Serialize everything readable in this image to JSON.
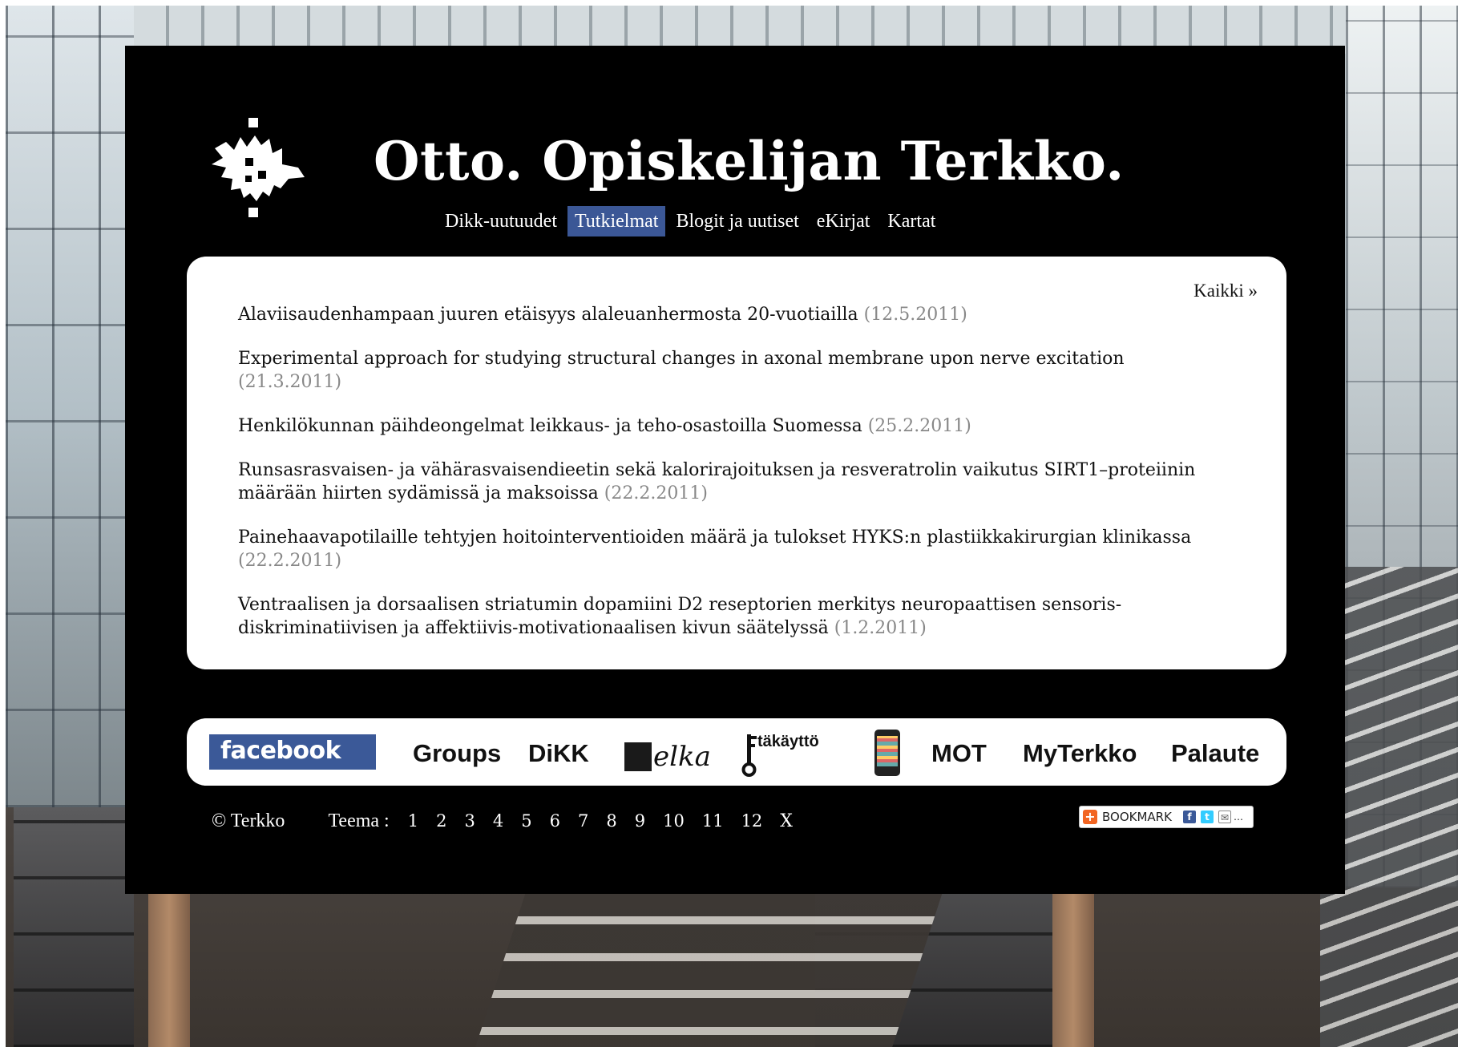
{
  "header": {
    "title": "Otto. Opiskelijan Terkko.",
    "logo_icon": "flame-crest-icon"
  },
  "nav": {
    "items": [
      {
        "label": "Dikk-uutuudet",
        "active": false
      },
      {
        "label": "Tutkielmat",
        "active": true
      },
      {
        "label": "Blogit ja uutiset",
        "active": false
      },
      {
        "label": "eKirjat",
        "active": false
      },
      {
        "label": "Kartat",
        "active": false
      }
    ],
    "active_color": "#3b5796"
  },
  "content": {
    "all_link": "Kaikki »",
    "items": [
      {
        "title": "Alaviisaudenhampaan juuren etäisyys alaleuanhermosta 20-vuotiailla",
        "date": "(12.5.2011)"
      },
      {
        "title": "Experimental approach for studying structural changes in axonal membrane upon nerve excitation",
        "date": "(21.3.2011)"
      },
      {
        "title": "Henkilökunnan päihdeongelmat leikkaus- ja teho-osastoilla Suomessa",
        "date": "(25.2.2011)"
      },
      {
        "title": "Runsasrasvaisen- ja vähärasvaisendieetin sekä kalorirajoituksen ja resveratrolin vaikutus SIRT1–proteiinin määrään hiirten sydämissä ja maksoissa",
        "date": "(22.2.2011)"
      },
      {
        "title": "Painehaavapotilaille tehtyjen hoitointerventioiden määrä ja tulokset HYKS:n plastiikkakirurgian klinikassa",
        "date": "(22.2.2011)"
      },
      {
        "title": "Ventraalisen ja dorsaalisen striatumin dopamiini D2 reseptorien merkitys neuropaattisen sensoris-diskriminatiivisen ja affektiivis-motivationaalisen kivun säätelyssä",
        "date": "(1.2.2011)"
      }
    ]
  },
  "linkbar": {
    "facebook": "facebook",
    "groups": "Groups",
    "dikk": "DiKK",
    "helka": "elka",
    "remote": "täkäyttö",
    "phone_icon": "mobile-phone-icon",
    "mot": "MOT",
    "myterkko": "MyTerkko",
    "palaute": "Palaute",
    "facebook_color": "#3b5998"
  },
  "footer": {
    "copyright": "© Terkko",
    "teema_label": "Teema :",
    "themes": [
      "1",
      "2",
      "3",
      "4",
      "5",
      "6",
      "7",
      "8",
      "9",
      "10",
      "11",
      "12",
      "X"
    ],
    "bookmark_label": "BOOKMARK"
  }
}
